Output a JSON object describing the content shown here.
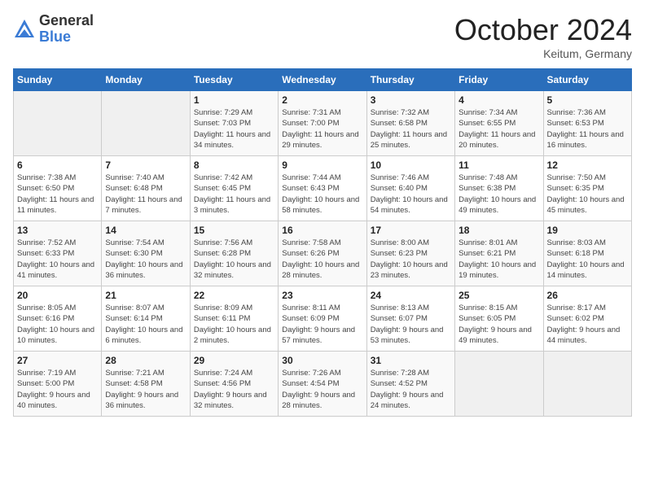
{
  "header": {
    "logo_general": "General",
    "logo_blue": "Blue",
    "title": "October 2024",
    "location": "Keitum, Germany"
  },
  "weekdays": [
    "Sunday",
    "Monday",
    "Tuesday",
    "Wednesday",
    "Thursday",
    "Friday",
    "Saturday"
  ],
  "weeks": [
    [
      {
        "day": "",
        "sunrise": "",
        "sunset": "",
        "daylight": ""
      },
      {
        "day": "",
        "sunrise": "",
        "sunset": "",
        "daylight": ""
      },
      {
        "day": "1",
        "sunrise": "Sunrise: 7:29 AM",
        "sunset": "Sunset: 7:03 PM",
        "daylight": "Daylight: 11 hours and 34 minutes."
      },
      {
        "day": "2",
        "sunrise": "Sunrise: 7:31 AM",
        "sunset": "Sunset: 7:00 PM",
        "daylight": "Daylight: 11 hours and 29 minutes."
      },
      {
        "day": "3",
        "sunrise": "Sunrise: 7:32 AM",
        "sunset": "Sunset: 6:58 PM",
        "daylight": "Daylight: 11 hours and 25 minutes."
      },
      {
        "day": "4",
        "sunrise": "Sunrise: 7:34 AM",
        "sunset": "Sunset: 6:55 PM",
        "daylight": "Daylight: 11 hours and 20 minutes."
      },
      {
        "day": "5",
        "sunrise": "Sunrise: 7:36 AM",
        "sunset": "Sunset: 6:53 PM",
        "daylight": "Daylight: 11 hours and 16 minutes."
      }
    ],
    [
      {
        "day": "6",
        "sunrise": "Sunrise: 7:38 AM",
        "sunset": "Sunset: 6:50 PM",
        "daylight": "Daylight: 11 hours and 11 minutes."
      },
      {
        "day": "7",
        "sunrise": "Sunrise: 7:40 AM",
        "sunset": "Sunset: 6:48 PM",
        "daylight": "Daylight: 11 hours and 7 minutes."
      },
      {
        "day": "8",
        "sunrise": "Sunrise: 7:42 AM",
        "sunset": "Sunset: 6:45 PM",
        "daylight": "Daylight: 11 hours and 3 minutes."
      },
      {
        "day": "9",
        "sunrise": "Sunrise: 7:44 AM",
        "sunset": "Sunset: 6:43 PM",
        "daylight": "Daylight: 10 hours and 58 minutes."
      },
      {
        "day": "10",
        "sunrise": "Sunrise: 7:46 AM",
        "sunset": "Sunset: 6:40 PM",
        "daylight": "Daylight: 10 hours and 54 minutes."
      },
      {
        "day": "11",
        "sunrise": "Sunrise: 7:48 AM",
        "sunset": "Sunset: 6:38 PM",
        "daylight": "Daylight: 10 hours and 49 minutes."
      },
      {
        "day": "12",
        "sunrise": "Sunrise: 7:50 AM",
        "sunset": "Sunset: 6:35 PM",
        "daylight": "Daylight: 10 hours and 45 minutes."
      }
    ],
    [
      {
        "day": "13",
        "sunrise": "Sunrise: 7:52 AM",
        "sunset": "Sunset: 6:33 PM",
        "daylight": "Daylight: 10 hours and 41 minutes."
      },
      {
        "day": "14",
        "sunrise": "Sunrise: 7:54 AM",
        "sunset": "Sunset: 6:30 PM",
        "daylight": "Daylight: 10 hours and 36 minutes."
      },
      {
        "day": "15",
        "sunrise": "Sunrise: 7:56 AM",
        "sunset": "Sunset: 6:28 PM",
        "daylight": "Daylight: 10 hours and 32 minutes."
      },
      {
        "day": "16",
        "sunrise": "Sunrise: 7:58 AM",
        "sunset": "Sunset: 6:26 PM",
        "daylight": "Daylight: 10 hours and 28 minutes."
      },
      {
        "day": "17",
        "sunrise": "Sunrise: 8:00 AM",
        "sunset": "Sunset: 6:23 PM",
        "daylight": "Daylight: 10 hours and 23 minutes."
      },
      {
        "day": "18",
        "sunrise": "Sunrise: 8:01 AM",
        "sunset": "Sunset: 6:21 PM",
        "daylight": "Daylight: 10 hours and 19 minutes."
      },
      {
        "day": "19",
        "sunrise": "Sunrise: 8:03 AM",
        "sunset": "Sunset: 6:18 PM",
        "daylight": "Daylight: 10 hours and 14 minutes."
      }
    ],
    [
      {
        "day": "20",
        "sunrise": "Sunrise: 8:05 AM",
        "sunset": "Sunset: 6:16 PM",
        "daylight": "Daylight: 10 hours and 10 minutes."
      },
      {
        "day": "21",
        "sunrise": "Sunrise: 8:07 AM",
        "sunset": "Sunset: 6:14 PM",
        "daylight": "Daylight: 10 hours and 6 minutes."
      },
      {
        "day": "22",
        "sunrise": "Sunrise: 8:09 AM",
        "sunset": "Sunset: 6:11 PM",
        "daylight": "Daylight: 10 hours and 2 minutes."
      },
      {
        "day": "23",
        "sunrise": "Sunrise: 8:11 AM",
        "sunset": "Sunset: 6:09 PM",
        "daylight": "Daylight: 9 hours and 57 minutes."
      },
      {
        "day": "24",
        "sunrise": "Sunrise: 8:13 AM",
        "sunset": "Sunset: 6:07 PM",
        "daylight": "Daylight: 9 hours and 53 minutes."
      },
      {
        "day": "25",
        "sunrise": "Sunrise: 8:15 AM",
        "sunset": "Sunset: 6:05 PM",
        "daylight": "Daylight: 9 hours and 49 minutes."
      },
      {
        "day": "26",
        "sunrise": "Sunrise: 8:17 AM",
        "sunset": "Sunset: 6:02 PM",
        "daylight": "Daylight: 9 hours and 44 minutes."
      }
    ],
    [
      {
        "day": "27",
        "sunrise": "Sunrise: 7:19 AM",
        "sunset": "Sunset: 5:00 PM",
        "daylight": "Daylight: 9 hours and 40 minutes."
      },
      {
        "day": "28",
        "sunrise": "Sunrise: 7:21 AM",
        "sunset": "Sunset: 4:58 PM",
        "daylight": "Daylight: 9 hours and 36 minutes."
      },
      {
        "day": "29",
        "sunrise": "Sunrise: 7:24 AM",
        "sunset": "Sunset: 4:56 PM",
        "daylight": "Daylight: 9 hours and 32 minutes."
      },
      {
        "day": "30",
        "sunrise": "Sunrise: 7:26 AM",
        "sunset": "Sunset: 4:54 PM",
        "daylight": "Daylight: 9 hours and 28 minutes."
      },
      {
        "day": "31",
        "sunrise": "Sunrise: 7:28 AM",
        "sunset": "Sunset: 4:52 PM",
        "daylight": "Daylight: 9 hours and 24 minutes."
      },
      {
        "day": "",
        "sunrise": "",
        "sunset": "",
        "daylight": ""
      },
      {
        "day": "",
        "sunrise": "",
        "sunset": "",
        "daylight": ""
      }
    ]
  ]
}
